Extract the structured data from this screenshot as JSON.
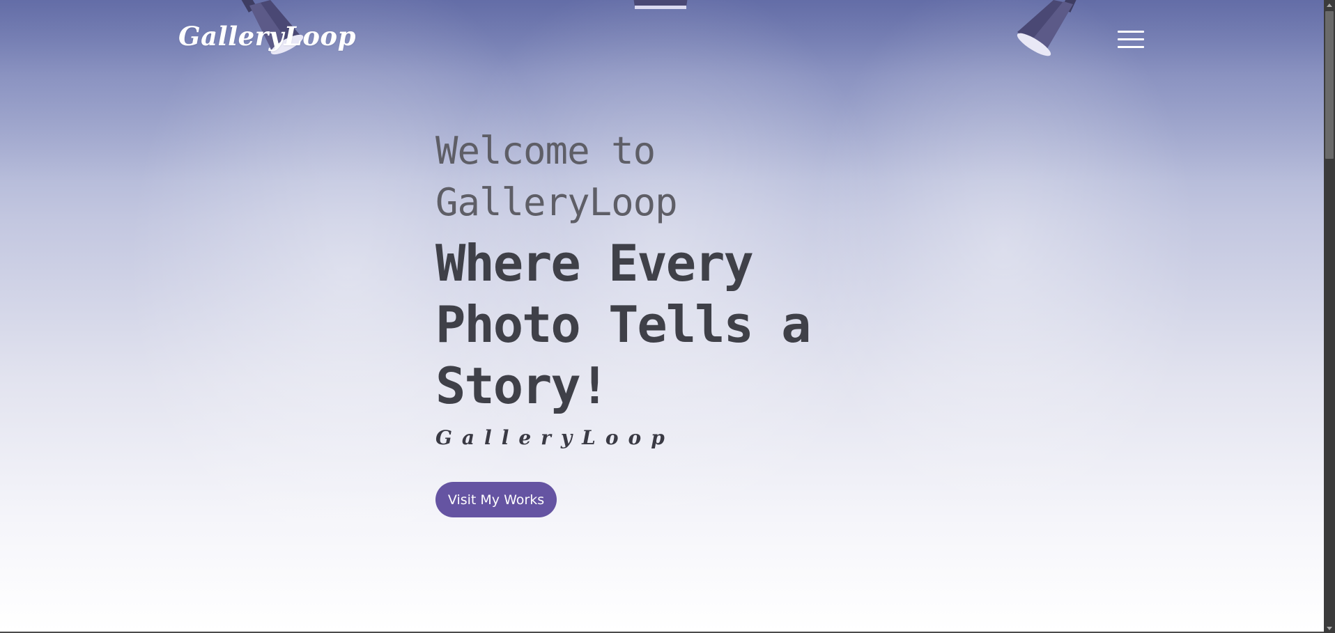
{
  "header": {
    "logo": "GalleryLoop",
    "menu_icon": "hamburger-menu-icon"
  },
  "hero": {
    "welcome_line1": "Welcome to",
    "welcome_line2": "GalleryLoop",
    "tagline_line1": "Where Every",
    "tagline_line2": "Photo Tells a",
    "tagline_line3": "Story!",
    "subtitle": "GalleryLoop",
    "cta_label": "Visit My Works"
  },
  "colors": {
    "accent": "#6554a2",
    "background_top": "#6e7ab0",
    "background_bottom": "#ffffff",
    "heading_text": "#3f4048",
    "welcome_text": "#5e5e66"
  },
  "decor": {
    "lamps": [
      "spotlight-lamp-icon",
      "spotlight-lamp-icon",
      "spotlight-lamp-icon"
    ]
  }
}
